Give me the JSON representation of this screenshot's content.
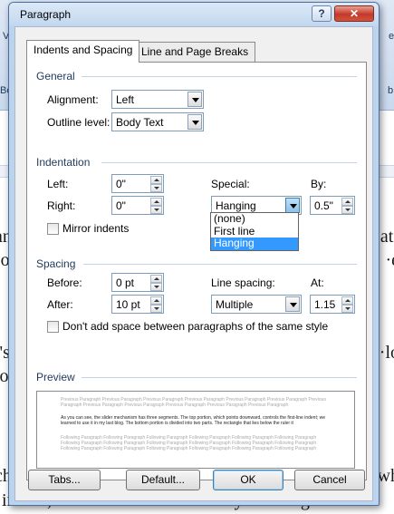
{
  "dialog": {
    "title": "Paragraph",
    "help_glyph": "?",
    "close_glyph": "✕"
  },
  "tabs": [
    {
      "label": "Indents and Spacing",
      "active": true
    },
    {
      "label": "Line and Page Breaks",
      "active": false
    }
  ],
  "general": {
    "section_label": "General",
    "alignment_label": "Alignment:",
    "alignment_value": "Left",
    "outline_label": "Outline level:",
    "outline_value": "Body Text"
  },
  "indentation": {
    "section_label": "Indentation",
    "left_label": "Left:",
    "left_value": "0\"",
    "right_label": "Right:",
    "right_value": "0\"",
    "special_label": "Special:",
    "special_value": "Hanging",
    "special_options": [
      "(none)",
      "First line",
      "Hanging"
    ],
    "special_selected": "Hanging",
    "by_label": "By:",
    "by_value": "0.5\"",
    "mirror_label": "Mirror indents",
    "mirror_checked": false
  },
  "spacing": {
    "section_label": "Spacing",
    "before_label": "Before:",
    "before_value": "0 pt",
    "after_label": "After:",
    "after_value": "10 pt",
    "line_spacing_label": "Line spacing:",
    "line_spacing_value": "Multiple",
    "at_label": "At:",
    "at_value": "1.15",
    "dont_add_label": "Don't add space between paragraphs of the same style",
    "dont_add_checked": false
  },
  "preview": {
    "section_label": "Preview",
    "previous_text": "Previous Paragraph Previous Paragraph Previous Paragraph Previous Paragraph Previous Paragraph Previous Paragraph Previous Paragraph Previous Paragraph Previous Paragraph Previous Paragraph Previous Paragraph Previous Paragraph",
    "sample_text": "As you can see, the slider mechanism has three segments. The top portion, which points downward, controls the first-line indent; we learned to use it in my last blog. The bottom portion is divided into two parts. The rectangle that lies below the ruler it",
    "following_text": "Following Paragraph Following Paragraph Following Paragraph Following Paragraph Following Paragraph Following Paragraph Following Paragraph Following Paragraph Following Paragraph Following Paragraph Following Paragraph Following Paragraph Following Paragraph Following Paragraph Following Paragraph Following Paragraph Following Paragraph Following Paragraph"
  },
  "buttons": {
    "tabs": "Tabs...",
    "default": "Default...",
    "ok": "OK",
    "cancel": "Cancel"
  },
  "background": {
    "ribbon_texts": [
      "Vi",
      "Boo",
      "b",
      "e"
    ],
    "doc_lines_left": [
      "an",
      "·o",
      "t's",
      "lo",
      "ch",
      "indent, we learned to use it in my last blog. The b"
    ],
    "doc_lines_right": [
      "at·",
      "·e",
      "·lo",
      "wh"
    ]
  },
  "colors": {
    "titlebar": "#c2d7ef",
    "client": "#f0f0f0",
    "selection": "#3399ff",
    "section_text": "#1e395b",
    "close_button": "#c4382a"
  }
}
